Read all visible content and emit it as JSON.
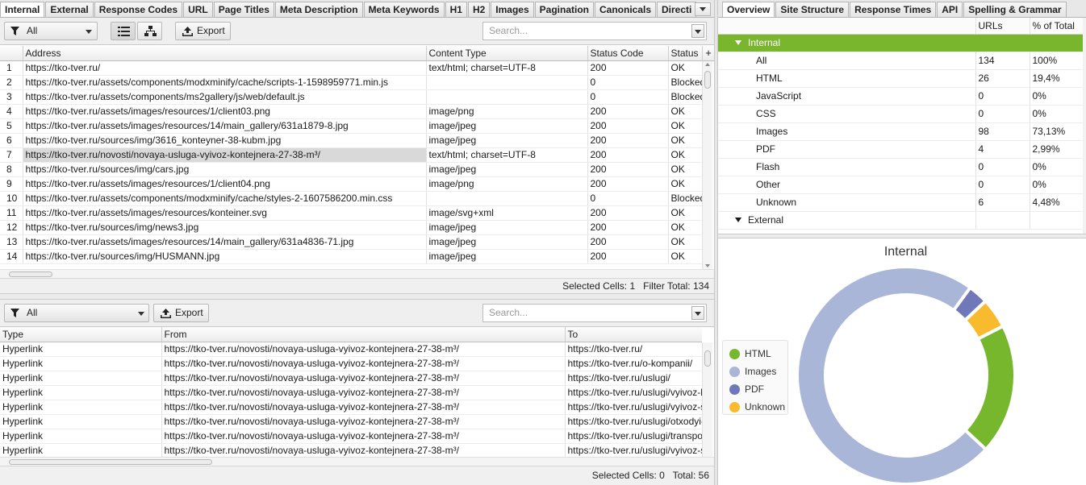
{
  "tabs": [
    "Internal",
    "External",
    "Response Codes",
    "URL",
    "Page Titles",
    "Meta Description",
    "Meta Keywords",
    "H1",
    "H2",
    "Images",
    "Pagination",
    "Canonicals",
    "Directi"
  ],
  "toolbar": {
    "filter": "All",
    "export": "Export",
    "search_placeholder": "Search..."
  },
  "main_table": {
    "columns": [
      "Address",
      "Content Type",
      "Status Code",
      "Status"
    ],
    "add_column": "+",
    "rows": [
      [
        "1",
        "https://tko-tver.ru/",
        "text/html; charset=UTF-8",
        "200",
        "OK"
      ],
      [
        "2",
        "https://tko-tver.ru/assets/components/modxminify/cache/scripts-1-1598959771.min.js",
        "",
        "0",
        "Blocked"
      ],
      [
        "3",
        "https://tko-tver.ru/assets/components/ms2gallery/js/web/default.js",
        "",
        "0",
        "Blocked"
      ],
      [
        "4",
        "https://tko-tver.ru/assets/images/resources/1/client03.png",
        "image/png",
        "200",
        "OK"
      ],
      [
        "5",
        "https://tko-tver.ru/assets/images/resources/14/main_gallery/631a1879-8.jpg",
        "image/jpeg",
        "200",
        "OK"
      ],
      [
        "6",
        "https://tko-tver.ru/sources/img/3616_konteyner-38-kubm.jpg",
        "image/jpeg",
        "200",
        "OK"
      ],
      [
        "7",
        "https://tko-tver.ru/novosti/novaya-usluga-vyivoz-kontejnera-27-38-m³/",
        "text/html; charset=UTF-8",
        "200",
        "OK"
      ],
      [
        "8",
        "https://tko-tver.ru/sources/img/cars.jpg",
        "image/jpeg",
        "200",
        "OK"
      ],
      [
        "9",
        "https://tko-tver.ru/assets/images/resources/1/client04.png",
        "image/png",
        "200",
        "OK"
      ],
      [
        "10",
        "https://tko-tver.ru/assets/components/modxminify/cache/styles-2-1607586200.min.css",
        "",
        "0",
        "Blocked"
      ],
      [
        "11",
        "https://tko-tver.ru/assets/images/resources/konteiner.svg",
        "image/svg+xml",
        "200",
        "OK"
      ],
      [
        "12",
        "https://tko-tver.ru/sources/img/news3.jpg",
        "image/jpeg",
        "200",
        "OK"
      ],
      [
        "13",
        "https://tko-tver.ru/assets/images/resources/14/main_gallery/631a4836-71.jpg",
        "image/jpeg",
        "200",
        "OK"
      ],
      [
        "14",
        "https://tko-tver.ru/sources/img/HUSMANN.jpg",
        "image/jpeg",
        "200",
        "OK"
      ]
    ],
    "selected_row": "7",
    "status_label1": "Selected Cells:",
    "status_value1": "1",
    "status_label2": "Filter Total:",
    "status_value2": "134"
  },
  "bottom_toolbar": {
    "filter": "All",
    "export": "Export",
    "search_placeholder": "Search..."
  },
  "links_table": {
    "columns": [
      "Type",
      "From",
      "To"
    ],
    "rows": [
      [
        "Hyperlink",
        "https://tko-tver.ru/novosti/novaya-usluga-vyivoz-kontejnera-27-38-m³/",
        "https://tko-tver.ru/"
      ],
      [
        "Hyperlink",
        "https://tko-tver.ru/novosti/novaya-usluga-vyivoz-kontejnera-27-38-m³/",
        "https://tko-tver.ru/o-kompanii/"
      ],
      [
        "Hyperlink",
        "https://tko-tver.ru/novosti/novaya-usluga-vyivoz-kontejnera-27-38-m³/",
        "https://tko-tver.ru/uslugi/"
      ],
      [
        "Hyperlink",
        "https://tko-tver.ru/novosti/novaya-usluga-vyivoz-kontejnera-27-38-m³/",
        "https://tko-tver.ru/uslugi/vyivoz-k"
      ],
      [
        "Hyperlink",
        "https://tko-tver.ru/novosti/novaya-usluga-vyivoz-kontejnera-27-38-m³/",
        "https://tko-tver.ru/uslugi/vyivoz-s"
      ],
      [
        "Hyperlink",
        "https://tko-tver.ru/novosti/novaya-usluga-vyivoz-kontejnera-27-38-m³/",
        "https://tko-tver.ru/uslugi/otxodyi-"
      ],
      [
        "Hyperlink",
        "https://tko-tver.ru/novosti/novaya-usluga-vyivoz-kontejnera-27-38-m³/",
        "https://tko-tver.ru/uslugi/transpo"
      ],
      [
        "Hyperlink",
        "https://tko-tver.ru/novosti/novaya-usluga-vyivoz-kontejnera-27-38-m³/",
        "https://tko-tver.ru/uslugi/vyivoz-s"
      ]
    ],
    "status_label1": "Selected Cells:",
    "status_value1": "0",
    "status_label2": "Total:",
    "status_value2": "56"
  },
  "right_tabs": [
    "Overview",
    "Site Structure",
    "Response Times",
    "API",
    "Spelling & Grammar"
  ],
  "overview": {
    "columns": [
      "URLs",
      "% of Total"
    ],
    "internal_label": "Internal",
    "external_label": "External",
    "rows": [
      [
        "All",
        "134",
        "100%"
      ],
      [
        "HTML",
        "26",
        "19,4%"
      ],
      [
        "JavaScript",
        "0",
        "0%"
      ],
      [
        "CSS",
        "0",
        "0%"
      ],
      [
        "Images",
        "98",
        "73,13%"
      ],
      [
        "PDF",
        "4",
        "2,99%"
      ],
      [
        "Flash",
        "0",
        "0%"
      ],
      [
        "Other",
        "0",
        "0%"
      ],
      [
        "Unknown",
        "6",
        "4,48%"
      ]
    ]
  },
  "chart_data": {
    "type": "pie",
    "title": "Internal",
    "categories": [
      "HTML",
      "Images",
      "PDF",
      "Unknown"
    ],
    "values": [
      26,
      98,
      4,
      6
    ],
    "colors": [
      "#77b72e",
      "#a9b6d8",
      "#6f79b9",
      "#f8bb2e"
    ],
    "legend": "left"
  }
}
